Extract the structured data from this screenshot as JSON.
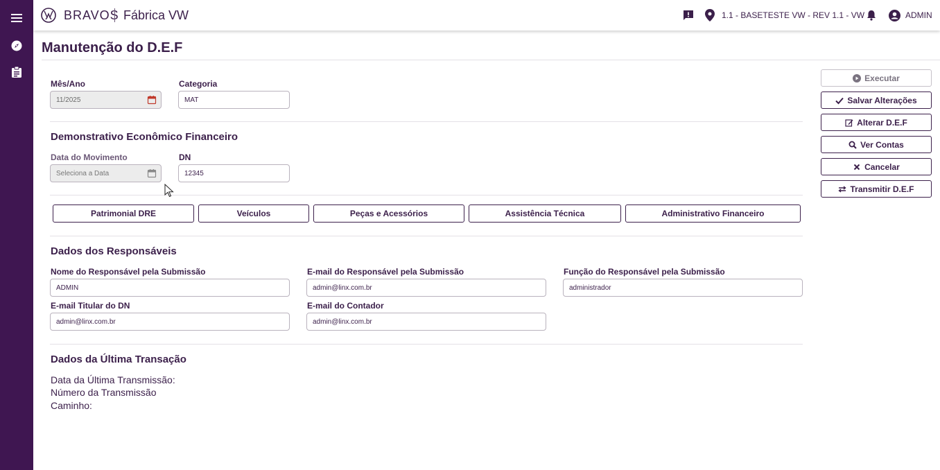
{
  "app": {
    "brand": "BRAVOS",
    "subtitle": "Fábrica VW",
    "location": "1.1 - BASETESTE VW - REV 1.1 - VW",
    "user": "ADMIN"
  },
  "sidebar": {
    "icons": [
      "menu-icon",
      "compass-icon",
      "clipboard-icon"
    ]
  },
  "page": {
    "title": "Manutenção do D.E.F"
  },
  "filters": {
    "mes_ano_label": "Mês/Ano",
    "mes_ano_value": "11/2025",
    "categoria_label": "Categoria",
    "categoria_value": "MAT"
  },
  "def_section": {
    "title": "Demonstrativo Econômico Financeiro",
    "data_mov_label": "Data do Movimento",
    "data_mov_placeholder": "Seleciona a Data",
    "dn_label": "DN",
    "dn_value": "12345"
  },
  "tabs": [
    "Patrimonial DRE",
    "Veículos",
    "Peças e Acessórios",
    "Assistência Técnica",
    "Administrativo Financeiro"
  ],
  "responsaveis": {
    "title": "Dados dos Responsáveis",
    "nome_label": "Nome do Responsável pela Submissão",
    "nome_value": "ADMIN",
    "email_resp_label": "E-mail do Responsável pela Submissão",
    "email_resp_value": "admin@linx.com.br",
    "funcao_label": "Função do Responsável pela Submissão",
    "funcao_value": "administrador",
    "email_titular_label": "E-mail Titular do DN",
    "email_titular_value": "admin@linx.com.br",
    "email_contador_label": "E-mail do Contador",
    "email_contador_value": "admin@linx.com.br"
  },
  "ultima_transacao": {
    "title": "Dados da Última Transação",
    "data_label": "Data da Última Transmissão:",
    "numero_label": "Número da Transmissão",
    "caminho_label": "Caminho:"
  },
  "actions": {
    "executar": "Executar",
    "salvar": "Salvar Alterações",
    "alterar": "Alterar D.E.F",
    "ver_contas": "Ver Contas",
    "cancelar": "Cancelar",
    "transmitir": "Transmitir D.E.F"
  },
  "colors": {
    "primary": "#3b1f4a",
    "sidebar": "#3f1651"
  }
}
